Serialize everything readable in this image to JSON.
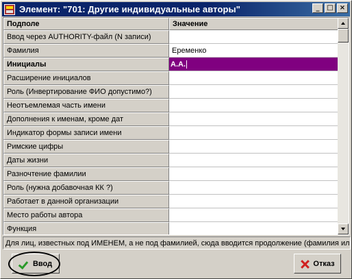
{
  "window": {
    "title": "Элемент: \"701: Другие индивидуальные авторы\"",
    "buttons": {
      "minimize": "_",
      "maximize": "□",
      "close": "×"
    }
  },
  "grid": {
    "columns": [
      "Подполе",
      "Значение"
    ],
    "rows": [
      {
        "name": "Ввод через AUTHORITY-файл (N записи)",
        "value": "",
        "bold": false,
        "selected": false
      },
      {
        "name": "Фамилия",
        "value": "Еременко",
        "bold": false,
        "selected": false
      },
      {
        "name": "Инициалы",
        "value": "А.А.",
        "bold": true,
        "selected": true
      },
      {
        "name": "Расширение инициалов",
        "value": "",
        "bold": false,
        "selected": false
      },
      {
        "name": "Роль (Инвертирование ФИО допустимо?)",
        "value": "",
        "bold": false,
        "selected": false
      },
      {
        "name": "Неотъемлемая часть имени",
        "value": "",
        "bold": false,
        "selected": false
      },
      {
        "name": "Дополнения к именам, кроме дат",
        "value": "",
        "bold": false,
        "selected": false
      },
      {
        "name": "Индикатор формы записи имени",
        "value": "",
        "bold": false,
        "selected": false
      },
      {
        "name": "Римские цифры",
        "value": "",
        "bold": false,
        "selected": false
      },
      {
        "name": "Даты жизни",
        "value": "",
        "bold": false,
        "selected": false
      },
      {
        "name": "Разночтение фамилии",
        "value": "",
        "bold": false,
        "selected": false
      },
      {
        "name": "Роль (нужна добавочная КК ?)",
        "value": "",
        "bold": false,
        "selected": false
      },
      {
        "name": "Работает в данной организации",
        "value": "",
        "bold": false,
        "selected": false
      },
      {
        "name": "Место работы автора",
        "value": "",
        "bold": false,
        "selected": false
      },
      {
        "name": "Функция",
        "value": "",
        "bold": false,
        "selected": false
      }
    ]
  },
  "hint": "Для лиц, известных под ИМЕНЕМ, а не под фамилией, сюда вводится продолжение (фамилия ил",
  "footer": {
    "ok_label": "Ввод",
    "cancel_label": "Отказ"
  },
  "icons": {
    "app": "app-icon",
    "ok": "checkmark-icon",
    "cancel": "x-icon"
  },
  "colors": {
    "selected_row": "#800080",
    "titlebar": "#0a246a",
    "ok_check": "#2a9a2a",
    "cancel_x": "#d02020"
  }
}
